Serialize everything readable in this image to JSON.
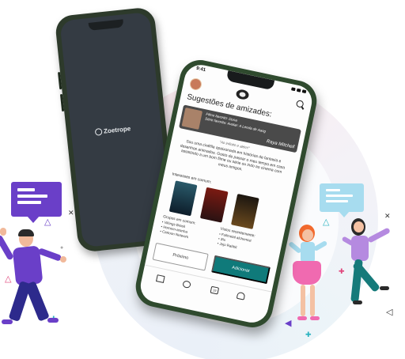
{
  "back_phone": {
    "logo_text": "Zoetrope",
    "logo_icon": "film-reel-icon"
  },
  "front_phone": {
    "status_time": "9:41",
    "header": {
      "avatar_icon": "avatar",
      "logo_icon": "film-reel-icon",
      "search_icon": "search-icon"
    },
    "title": "Sugestões de amizades:",
    "profile": {
      "favorite_movie": "Filme favorito: Duna",
      "favorite_series": "Série favorita: Avatar: A Lenda de Aang",
      "name": "Raya Mitchell"
    },
    "quote": "\"Ao infinito e além!\"",
    "bio": "Sou uma cinéfila apaixonada em histórias de fantasia e desenhos animados. Gosto de passar o meu tempo em casa assistindo a um bom filme ou série ou indo ao cinema com meus amigos.",
    "interests_label": "Interesses em comum:",
    "posters": [
      "poster-1",
      "poster-2",
      "poster-3"
    ],
    "groups": {
      "heading": "Grupos em comum:",
      "items": [
        "Vikings Brasil",
        "Homem-aranha",
        "Cartoon Network"
      ]
    },
    "recent": {
      "heading": "Vistos recentemente:",
      "items": [
        "Fullmetal alchemist",
        "3%",
        "Jojo Rabbit"
      ]
    },
    "buttons": {
      "next": "Próximo",
      "add": "Adicionar"
    },
    "tabbar": {
      "home_icon": "home-icon",
      "add_friend_icon": "add-friend-icon",
      "calendar_label": "19",
      "bell_icon": "bell-icon"
    }
  },
  "colors": {
    "accent": "#0f7a7a",
    "phone_frame": "#2f4a2e",
    "bubble_left": "#6a3fc8",
    "bubble_right": "#a7dcef"
  }
}
